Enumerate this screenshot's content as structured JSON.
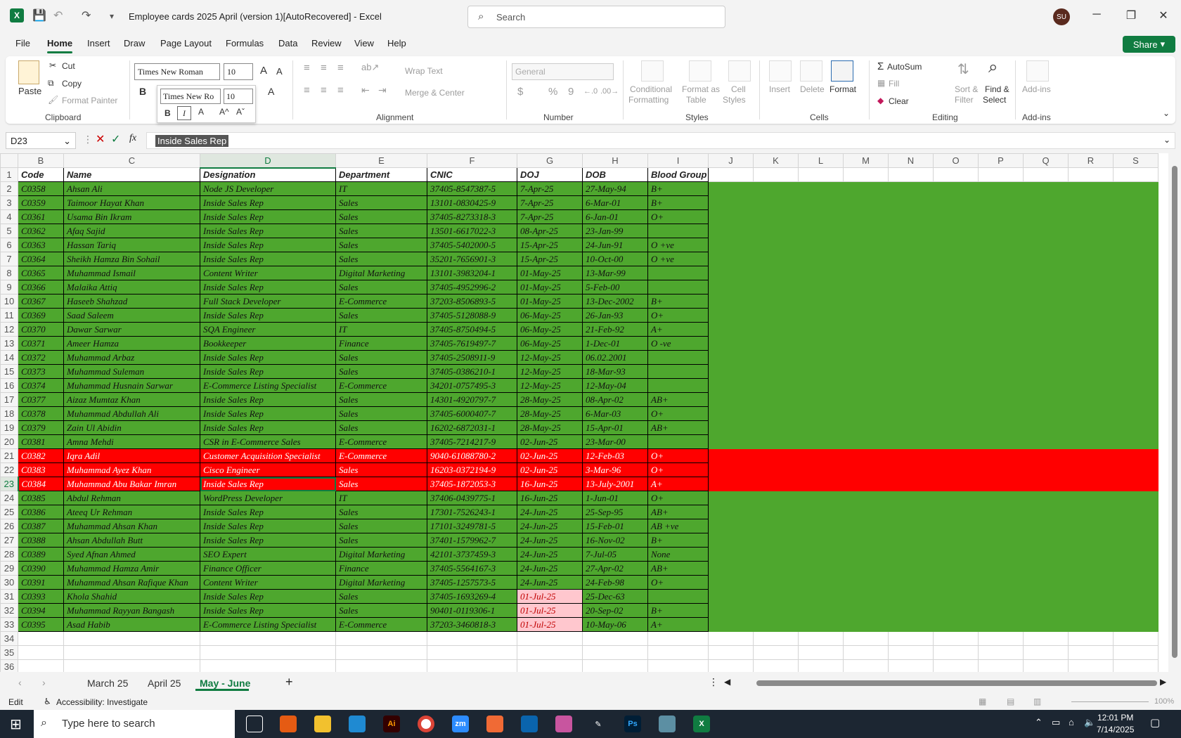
{
  "window": {
    "title": "Employee cards 2025 April (version 1)[AutoRecovered]  -  Excel",
    "search_placeholder": "Search",
    "user_initials": "SU",
    "share_label": "Share"
  },
  "menu": [
    "File",
    "Home",
    "Insert",
    "Draw",
    "Page Layout",
    "Formulas",
    "Data",
    "Review",
    "View",
    "Help"
  ],
  "ribbon": {
    "clipboard": {
      "paste": "Paste",
      "cut": "Cut",
      "copy": "Copy",
      "format_painter": "Format Painter",
      "label": "Clipboard"
    },
    "font": {
      "name": "Times New Roman",
      "size": "10",
      "bold": "B"
    },
    "mini": {
      "font": "Times New Ro",
      "size": "10",
      "bold": "B",
      "italic": "I",
      "color": "A",
      "grow": "A^",
      "shrink": "Aˇ"
    },
    "alignment": {
      "wrap": "Wrap Text",
      "merge": "Merge & Center",
      "label": "Alignment"
    },
    "number": {
      "format": "General",
      "currency": "$",
      "percent": "%",
      "comma": "9",
      "label": "Number"
    },
    "styles": {
      "conditional": "Conditional",
      "formatting": "Formatting",
      "format_as": "Format as",
      "table": "Table",
      "cell": "Cell",
      "styles": "Styles",
      "label": "Styles"
    },
    "cells": {
      "insert": "Insert",
      "delete": "Delete",
      "format": "Format",
      "label": "Cells"
    },
    "editing": {
      "autosum": "AutoSum",
      "fill": "Fill",
      "clear": "Clear",
      "sort": "Sort &",
      "filter": "Filter",
      "find": "Find &",
      "select": "Select",
      "label": "Editing"
    },
    "addins": {
      "addins": "Add-ins",
      "label": "Add-ins"
    }
  },
  "formula_bar": {
    "name_box": "D23",
    "fx": "fx",
    "value": "Inside Sales Rep"
  },
  "sheet": {
    "columns": [
      "B",
      "C",
      "D",
      "E",
      "F",
      "G",
      "H",
      "I",
      "J",
      "K",
      "L",
      "M",
      "N",
      "O",
      "P",
      "Q",
      "R",
      "S"
    ],
    "headers": [
      "Code",
      "Name",
      "Designation",
      "Department",
      "CNIC",
      "DOJ",
      "DOB",
      "Blood Group"
    ],
    "rows": [
      {
        "n": "2",
        "code": "C0358",
        "name": "Ahsan Ali",
        "desig": "Node JS Developer",
        "dept": "IT",
        "cnic": "37405-8547387-5",
        "doj": "7-Apr-25",
        "dob": "27-May-94",
        "bg": "B+"
      },
      {
        "n": "3",
        "code": "C0359",
        "name": "Taimoor Hayat Khan",
        "desig": "Inside Sales Rep",
        "dept": "Sales",
        "cnic": "13101-0830425-9",
        "doj": "7-Apr-25",
        "dob": "6-Mar-01",
        "bg": "B+"
      },
      {
        "n": "4",
        "code": "C0361",
        "name": "Usama Bin Ikram",
        "desig": "Inside Sales Rep",
        "dept": "Sales",
        "cnic": "37405-8273318-3",
        "doj": "7-Apr-25",
        "dob": "6-Jan-01",
        "bg": "O+"
      },
      {
        "n": "5",
        "code": "C0362",
        "name": "Afaq Sajid",
        "desig": "Inside Sales Rep",
        "dept": "Sales",
        "cnic": "13501-6617022-3",
        "doj": "08-Apr-25",
        "dob": "23-Jan-99",
        "bg": ""
      },
      {
        "n": "6",
        "code": "C0363",
        "name": "Hassan Tariq",
        "desig": "Inside Sales Rep",
        "dept": "Sales",
        "cnic": "37405-5402000-5",
        "doj": "15-Apr-25",
        "dob": "24-Jun-91",
        "bg": "O +ve"
      },
      {
        "n": "7",
        "code": "C0364",
        "name": "Sheikh Hamza Bin Sohail",
        "desig": "Inside Sales Rep",
        "dept": "Sales",
        "cnic": "35201-7656901-3",
        "doj": "15-Apr-25",
        "dob": "10-Oct-00",
        "bg": "O +ve"
      },
      {
        "n": "8",
        "code": "C0365",
        "name": "Muhammad Ismail",
        "desig": "Content Writer",
        "dept": "Digital Marketing",
        "cnic": "13101-3983204-1",
        "doj": "01-May-25",
        "dob": "13-Mar-99",
        "bg": ""
      },
      {
        "n": "9",
        "code": "C0366",
        "name": "Malaika Attiq",
        "desig": "Inside Sales Rep",
        "dept": "Sales",
        "cnic": "37405-4952996-2",
        "doj": "01-May-25",
        "dob": "5-Feb-00",
        "bg": ""
      },
      {
        "n": "10",
        "code": "C0367",
        "name": "Haseeb Shahzad",
        "desig": "Full Stack Developer",
        "dept": "E-Commerce",
        "cnic": "37203-8506893-5",
        "doj": "01-May-25",
        "dob": "13-Dec-2002",
        "bg": "B+"
      },
      {
        "n": "11",
        "code": "C0369",
        "name": "Saad Saleem",
        "desig": "Inside Sales Rep",
        "dept": "Sales",
        "cnic": "37405-5128088-9",
        "doj": "06-May-25",
        "dob": "26-Jan-93",
        "bg": "O+"
      },
      {
        "n": "12",
        "code": "C0370",
        "name": "Dawar Sarwar",
        "desig": "SQA Engineer",
        "dept": "IT",
        "cnic": "37405-8750494-5",
        "doj": "06-May-25",
        "dob": "21-Feb-92",
        "bg": "A+"
      },
      {
        "n": "13",
        "code": "C0371",
        "name": "Ameer Hamza",
        "desig": "Bookkeeper",
        "dept": "Finance",
        "cnic": "37405-7619497-7",
        "doj": "06-May-25",
        "dob": "1-Dec-01",
        "bg": "O -ve"
      },
      {
        "n": "14",
        "code": "C0372",
        "name": "Muhammad Arbaz",
        "desig": "Inside Sales Rep",
        "dept": "Sales",
        "cnic": "37405-2508911-9",
        "doj": "12-May-25",
        "dob": "06.02.2001",
        "bg": ""
      },
      {
        "n": "15",
        "code": "C0373",
        "name": "Muhammad Suleman",
        "desig": "Inside Sales Rep",
        "dept": "Sales",
        "cnic": "37405-0386210-1",
        "doj": "12-May-25",
        "dob": "18-Mar-93",
        "bg": ""
      },
      {
        "n": "16",
        "code": "C0374",
        "name": "Muhammad Husnain Sarwar",
        "desig": "E-Commerce Listing Specialist",
        "dept": "E-Commerce",
        "cnic": "34201-0757495-3",
        "doj": "12-May-25",
        "dob": "12-May-04",
        "bg": ""
      },
      {
        "n": "17",
        "code": "C0377",
        "name": "Aizaz Mumtaz Khan",
        "desig": "Inside Sales Rep",
        "dept": "Sales",
        "cnic": "14301-4920797-7",
        "doj": "28-May-25",
        "dob": "08-Apr-02",
        "bg": "AB+"
      },
      {
        "n": "18",
        "code": "C0378",
        "name": "Muhammad Abdullah Ali",
        "desig": "Inside Sales Rep",
        "dept": "Sales",
        "cnic": "37405-6000407-7",
        "doj": "28-May-25",
        "dob": "6-Mar-03",
        "bg": "O+"
      },
      {
        "n": "19",
        "code": "C0379",
        "name": "Zain Ul Abidin",
        "desig": "Inside Sales Rep",
        "dept": "Sales",
        "cnic": "16202-6872031-1",
        "doj": "28-May-25",
        "dob": "15-Apr-01",
        "bg": "AB+"
      },
      {
        "n": "20",
        "code": "C0381",
        "name": "Amna Mehdi",
        "desig": "CSR in E-Commerce Sales",
        "dept": "E-Commerce",
        "cnic": "37405-7214217-9",
        "doj": "02-Jun-25",
        "dob": "23-Mar-00",
        "bg": ""
      },
      {
        "n": "21",
        "code": "C0382",
        "name": "Iqra Adil",
        "desig": "Customer Acquisition Specialist",
        "dept": "E-Commerce",
        "cnic": "9040-61088780-2",
        "doj": "02-Jun-25",
        "dob": "12-Feb-03",
        "bg": "O+",
        "red": true
      },
      {
        "n": "22",
        "code": "C0383",
        "name": "Muhammad Ayez Khan",
        "desig": "Cisco Engineer",
        "dept": "Sales",
        "cnic": "16203-0372194-9",
        "doj": "02-Jun-25",
        "dob": "3-Mar-96",
        "bg": "O+",
        "red": true
      },
      {
        "n": "23",
        "code": "C0384",
        "name": "Muhammad Abu Bakar Imran",
        "desig": "Inside Sales Rep",
        "dept": "Sales",
        "cnic": "37405-1872053-3",
        "doj": "16-Jun-25",
        "dob": "13-July-2001",
        "bg": "A+",
        "red": true
      },
      {
        "n": "24",
        "code": "C0385",
        "name": "Abdul Rehman",
        "desig": "WordPress Developer",
        "dept": "IT",
        "cnic": "37406-0439775-1",
        "doj": "16-Jun-25",
        "dob": "1-Jun-01",
        "bg": "O+"
      },
      {
        "n": "25",
        "code": "C0386",
        "name": "Ateeq Ur Rehman",
        "desig": "Inside Sales Rep",
        "dept": "Sales",
        "cnic": "17301-7526243-1",
        "doj": "24-Jun-25",
        "dob": "25-Sep-95",
        "bg": "AB+"
      },
      {
        "n": "26",
        "code": "C0387",
        "name": "Muhammad Ahsan Khan",
        "desig": "Inside Sales Rep",
        "dept": "Sales",
        "cnic": "17101-3249781-5",
        "doj": "24-Jun-25",
        "dob": "15-Feb-01",
        "bg": "AB +ve"
      },
      {
        "n": "27",
        "code": "C0388",
        "name": "Ahsan Abdullah Butt",
        "desig": "Inside Sales Rep",
        "dept": "Sales",
        "cnic": "37401-1579962-7",
        "doj": "24-Jun-25",
        "dob": "16-Nov-02",
        "bg": "B+"
      },
      {
        "n": "28",
        "code": "C0389",
        "name": "Syed Afnan Ahmed",
        "desig": "SEO Expert",
        "dept": "Digital Marketing",
        "cnic": "42101-3737459-3",
        "doj": "24-Jun-25",
        "dob": "7-Jul-05",
        "bg": "None"
      },
      {
        "n": "29",
        "code": "C0390",
        "name": "Muhammad Hamza Amir",
        "desig": "Finance Officer",
        "dept": "Finance",
        "cnic": "37405-5564167-3",
        "doj": "24-Jun-25",
        "dob": "27-Apr-02",
        "bg": "AB+"
      },
      {
        "n": "30",
        "code": "C0391",
        "name": "Muhammad Ahsan Rafique Khan",
        "desig": "Content Writer",
        "dept": "Digital Marketing",
        "cnic": "37405-1257573-5",
        "doj": "24-Jun-25",
        "dob": "24-Feb-98",
        "bg": "O+"
      },
      {
        "n": "31",
        "code": "C0393",
        "name": "Khola Shahid",
        "desig": "Inside Sales Rep",
        "dept": "Sales",
        "cnic": "37405-1693269-4",
        "doj": "01-Jul-25",
        "dob": "25-Dec-63",
        "bg": "",
        "pinkdoj": true
      },
      {
        "n": "32",
        "code": "C0394",
        "name": "Muhammad Rayyan Bangash",
        "desig": "Inside Sales Rep",
        "dept": "Sales",
        "cnic": "90401-0119306-1",
        "doj": "01-Jul-25",
        "dob": "20-Sep-02",
        "bg": "B+",
        "pinkdoj": true
      },
      {
        "n": "33",
        "code": "C0395",
        "name": "Asad Habib",
        "desig": "E-Commerce Listing Specialist",
        "dept": "E-Commerce",
        "cnic": "37203-3460818-3",
        "doj": "01-Jul-25",
        "dob": "10-May-06",
        "bg": "A+",
        "pinkdoj": true
      }
    ],
    "empty_rows": [
      "34",
      "35",
      "36"
    ]
  },
  "tabs": [
    "March 25",
    "April 25",
    "May - June"
  ],
  "status": {
    "mode": "Edit",
    "accessibility": "Accessibility: Investigate",
    "zoom": "100%"
  },
  "taskbar": {
    "search_placeholder": "Type here to search",
    "time": "12:01 PM",
    "date": "7/14/2025"
  },
  "colors": {
    "accent": "#107c41",
    "row_green": "#4ea72e",
    "row_red": "#ff0000",
    "pink": "#ffc7ce"
  }
}
